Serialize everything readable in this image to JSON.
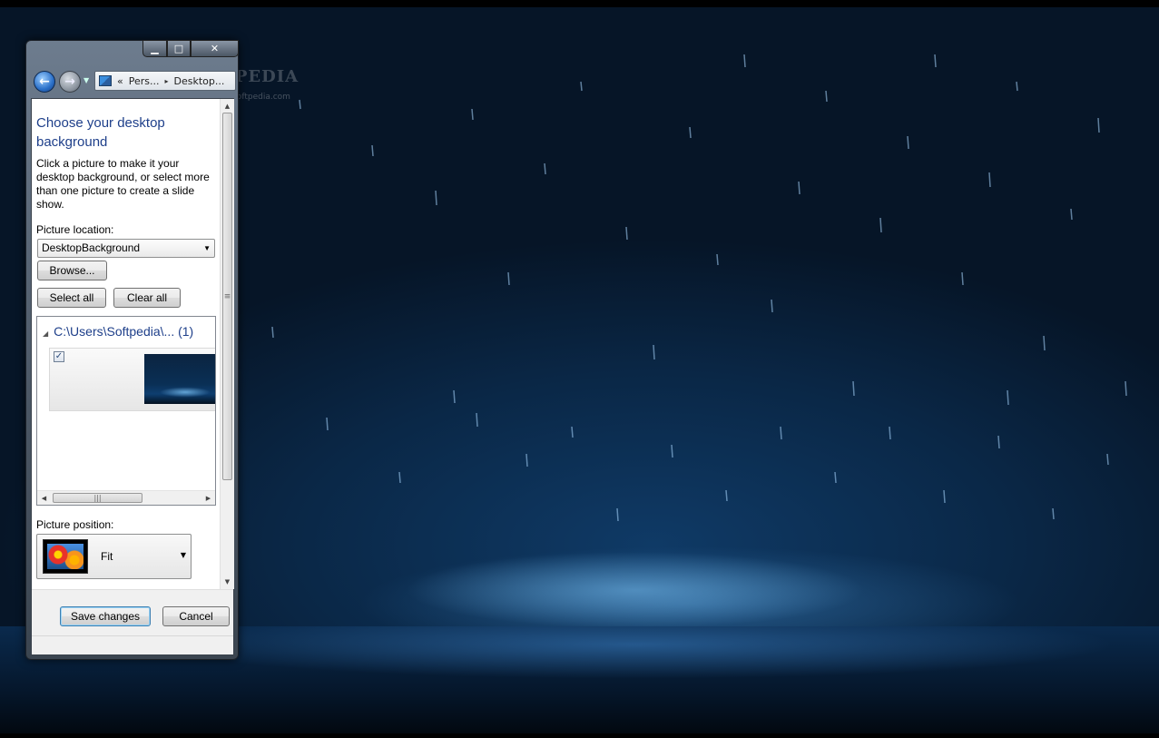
{
  "watermark": {
    "brand": "SOFTPEDIA",
    "url": "www.softpedia.com"
  },
  "window": {
    "caption": {
      "minimize": "▁",
      "maximize": "□",
      "close": "✕"
    },
    "nav": {
      "back_icon": "arrow-left-icon",
      "forward_icon": "arrow-right-icon",
      "breadcrumb_overflow": "«",
      "breadcrumb": [
        "Pers...",
        "Desktop..."
      ],
      "breadcrumb_separator": "▸"
    }
  },
  "page": {
    "title": "Choose your desktop background",
    "description": "Click a picture to make it your desktop background, or select more than one picture to create a slide show.",
    "picture_location_label": "Picture location:",
    "picture_location_value": "DesktopBackground",
    "browse_label": "Browse...",
    "select_all_label": "Select all",
    "clear_all_label": "Clear all",
    "group_header": "C:\\Users\\Softpedia\\... (1)",
    "thumbnail_checked": "✓",
    "picture_position_label": "Picture position:",
    "picture_position_value": "Fit"
  },
  "footer": {
    "save_label": "Save changes",
    "cancel_label": "Cancel"
  },
  "scrollbars": {
    "vertical_grip": "≡",
    "horizontal_grip": "|||"
  }
}
